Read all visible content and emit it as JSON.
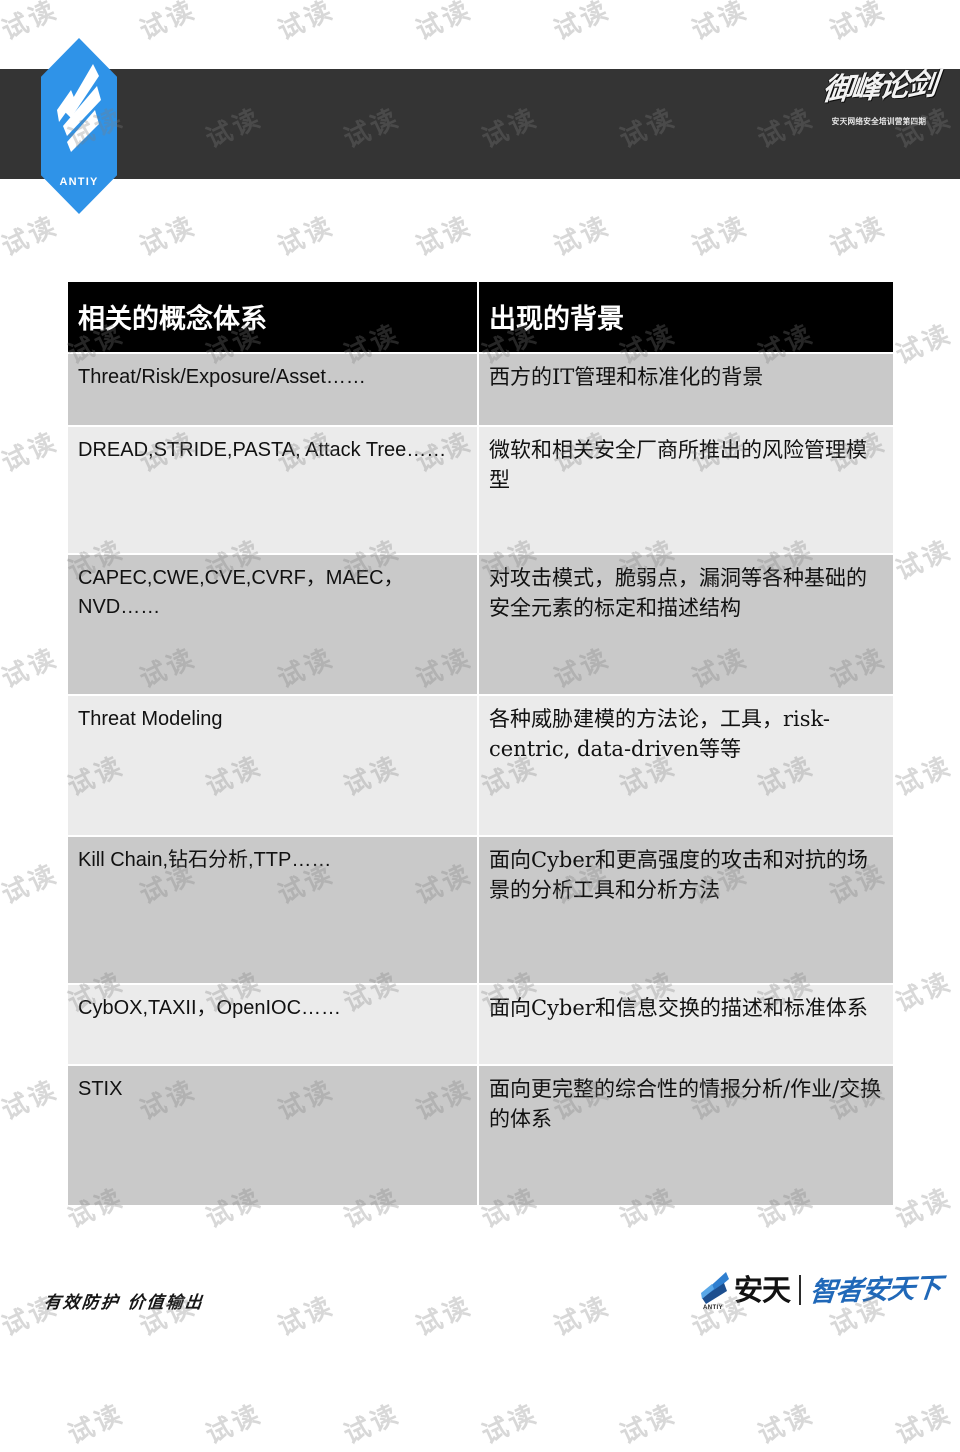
{
  "slide": {
    "brand": {
      "logo_wordmark": "ANTIY",
      "header_calligraphy": "御峰论剑",
      "header_calligraphy_sub": "安天网络安全培训营第四期"
    },
    "footer": {
      "slogan": "有效防护 价值输出",
      "logo_antiy_small": "ANTIY",
      "logo_name": "安天",
      "logo_tagline": "智者安天下"
    },
    "watermark": {
      "text": "试读"
    },
    "table": {
      "headers": {
        "col1": "相关的概念体系",
        "col2": "出现的背景"
      },
      "rows": [
        {
          "concept": "Threat/Risk/Exposure/Asset……",
          "background": "西方的IT管理和标准化的背景"
        },
        {
          "concept": "DREAD,STRIDE,PASTA, Attack Tree……",
          "background": "微软和相关安全厂商所推出的风险管理模型"
        },
        {
          "concept": "CAPEC,CWE,CVE,CVRF，MAEC，NVD……",
          "background": "对攻击模式，脆弱点，漏洞等各种基础的安全元素的标定和描述结构"
        },
        {
          "concept": "Threat Modeling",
          "background": "各种威胁建模的方法论，工具，risk-centric, data-driven等等"
        },
        {
          "concept": "Kill Chain,钻石分析,TTP……",
          "background": "面向Cyber和更高强度的攻击和对抗的场景的分析工具和分析方法"
        },
        {
          "concept": "CybOX,TAXII，OpenIOC……",
          "background": "面向Cyber和信息交换的描述和标准体系"
        },
        {
          "concept": "STIX",
          "background": "面向更完整的综合性的情报分析/作业/交换的体系"
        }
      ]
    },
    "colors": {
      "header_band": "#343434",
      "brand_blue": "#2f93e8",
      "table_header_bg": "#000000",
      "row_dark": "#c9c9c9",
      "row_light": "#ebebeb",
      "tagline_blue": "#2068b8"
    }
  }
}
